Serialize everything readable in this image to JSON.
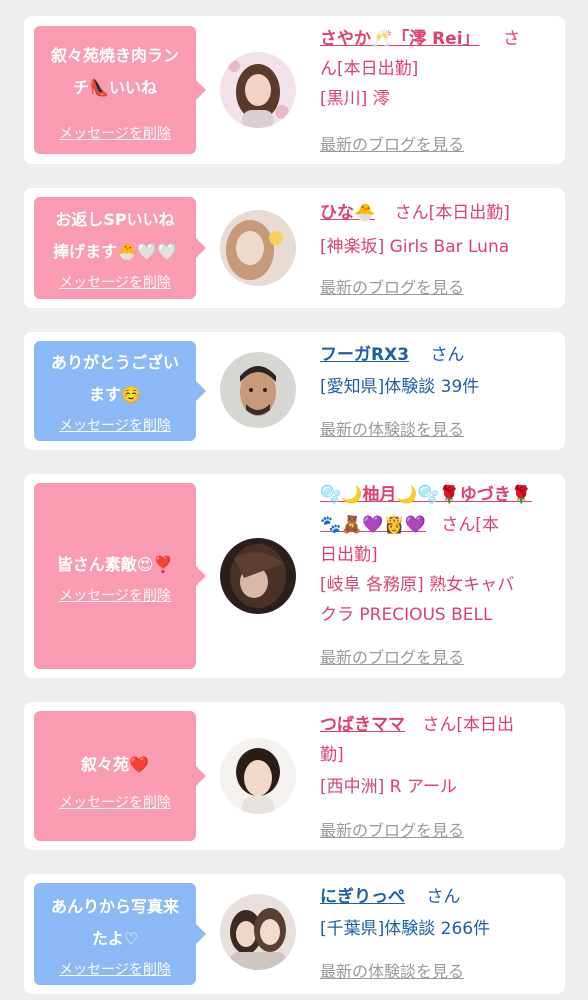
{
  "colors": {
    "pink_bubble": "#f89bb3",
    "blue_bubble": "#8cb8f5",
    "pink_text": "#e0406e",
    "blue_text": "#1f5ea8",
    "link_gray": "#999999",
    "background": "#eeeeee"
  },
  "items": [
    {
      "bubble_color": "pink",
      "message_lines": [
        "叙々苑焼き肉ラン",
        "チ👠いいね"
      ],
      "delete_label": "メッセージを削除",
      "avatar_icon": "avatar-woman-icon",
      "name": "さやか🥂「澪 Rei」",
      "name_suffix_lines": [
        "さ",
        "ん[本日出勤]"
      ],
      "detail_lines": [
        "[黒川] 澪"
      ],
      "latest_label": "最新のブログを見る"
    },
    {
      "bubble_color": "pink",
      "message_lines": [
        "お返しSPいいね",
        "捧げます🐣🤍🤍"
      ],
      "delete_label": "メッセージを削除",
      "avatar_icon": "avatar-woman-icon",
      "name": "ひな🐣",
      "name_suffix_lines": [
        "さん[本日出勤]"
      ],
      "detail_lines": [
        "[神楽坂] Girls Bar Luna"
      ],
      "latest_label": "最新のブログを見る"
    },
    {
      "bubble_color": "blue",
      "message_lines": [
        "ありがとうござい",
        "ます☺️"
      ],
      "delete_label": "メッセージを削除",
      "avatar_icon": "avatar-man-icon",
      "name": "フーガRX3",
      "name_suffix_lines": [
        "さん"
      ],
      "detail_lines": [
        "[愛知県]体験談 39件"
      ],
      "latest_label": "最新の体験談を見る"
    },
    {
      "bubble_color": "pink",
      "message_lines": [
        "皆さん素敵😍❣️"
      ],
      "delete_label": "メッセージを削除",
      "avatar_icon": "avatar-woman-icon",
      "name": "🫧🌙柚月🌙🫧🌹ゆづき🌹🐾🧸💜👸💜",
      "name_suffix_lines": [
        "さん[本",
        "日出勤]"
      ],
      "detail_lines": [
        "[岐阜 各務原] 熟女キャバ",
        "クラ PRECIOUS BELL"
      ],
      "latest_label": "最新のブログを見る"
    },
    {
      "bubble_color": "pink",
      "message_lines": [
        "叙々苑❤️"
      ],
      "delete_label": "メッセージを削除",
      "avatar_icon": "avatar-woman-icon",
      "name": "つばきママ",
      "name_suffix_lines": [
        "さん[本日出",
        "勤]"
      ],
      "detail_lines": [
        "[西中洲] R アール"
      ],
      "latest_label": "最新のブログを見る"
    },
    {
      "bubble_color": "blue",
      "message_lines": [
        "あんりから写真来",
        "たよ♡"
      ],
      "delete_label": "メッセージを削除",
      "avatar_icon": "avatar-couple-icon",
      "name": "にぎりっぺ",
      "name_suffix_lines": [
        "さん"
      ],
      "detail_lines": [
        "[千葉県]体験談 266件"
      ],
      "latest_label": "最新の体験談を見る"
    }
  ]
}
